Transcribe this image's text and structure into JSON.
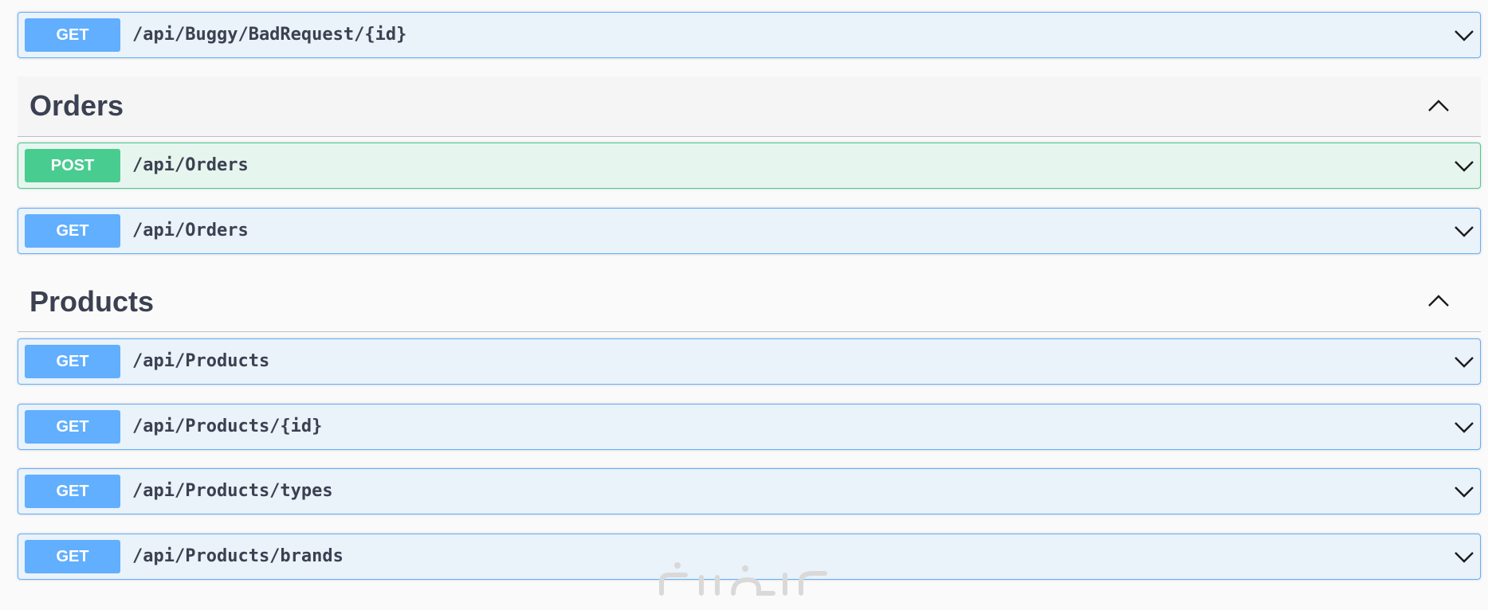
{
  "operations_top": [
    {
      "method": "GET",
      "path": "/api/Buggy/BadRequest/{id}"
    }
  ],
  "sections": [
    {
      "title": "Orders",
      "operations": [
        {
          "method": "POST",
          "path": "/api/Orders"
        },
        {
          "method": "GET",
          "path": "/api/Orders"
        }
      ]
    },
    {
      "title": "Products",
      "operations": [
        {
          "method": "GET",
          "path": "/api/Products"
        },
        {
          "method": "GET",
          "path": "/api/Products/{id}"
        },
        {
          "method": "GET",
          "path": "/api/Products/types"
        },
        {
          "method": "GET",
          "path": "/api/Products/brands"
        }
      ]
    }
  ],
  "icons": {
    "expand": "chevron-down-icon",
    "collapse": "chevron-up-icon"
  },
  "colors": {
    "get": "#61affe",
    "post": "#49cc90",
    "text": "#3b4151"
  }
}
